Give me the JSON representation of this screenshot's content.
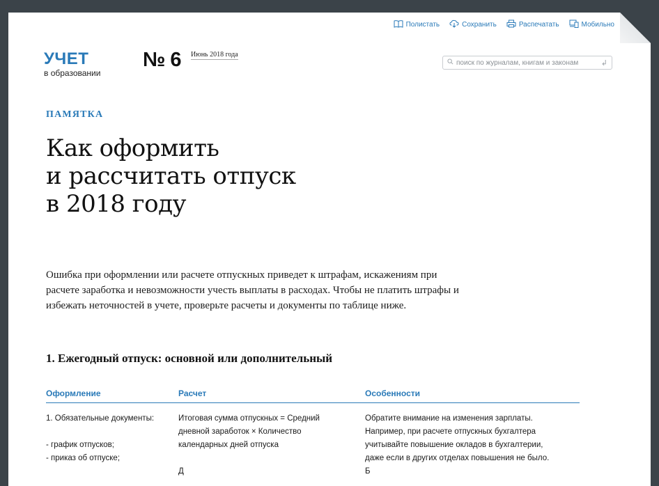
{
  "toolbar": {
    "items": [
      {
        "label": "Полистать",
        "icon": "book-icon"
      },
      {
        "label": "Сохранить",
        "icon": "cloud-download-icon"
      },
      {
        "label": "Распечатать",
        "icon": "printer-icon"
      },
      {
        "label": "Мобильно",
        "icon": "devices-icon"
      }
    ]
  },
  "logo": {
    "main": "УЧЕТ",
    "sub": "в образовании"
  },
  "issue": {
    "number": "№ 6",
    "date": "Июнь 2018 года"
  },
  "search": {
    "placeholder": "поиск по журналам, книгам и законам"
  },
  "article": {
    "kicker": "ПАМЯТКА",
    "title_lines": [
      "Как оформить",
      "и рассчитать отпуск",
      "в 2018 году"
    ],
    "lead": "Ошибка при оформлении или расчете отпускных приведет к штрафам, искажениям при расчете заработка и невозможности учесть выплаты в расходах. Чтобы не платить штрафы и избежать неточностей в учете, проверьте расчеты и документы по таблице ниже.",
    "section_title": "1. Ежегодный отпуск: основной или дополнительный"
  },
  "table": {
    "headers": [
      "Оформление",
      "Расчет",
      "Особенности"
    ],
    "col1": [
      "1. Обязательные документы:",
      "",
      "- график отпусков;",
      "- приказ об отпуске;"
    ],
    "col2": [
      "Итоговая сумма отпускных = Средний",
      "дневной заработок × Количество",
      "календарных дней отпуска",
      "",
      "Д"
    ],
    "col3": [
      "Обратите внимание на изменения зарплаты.",
      "Например, при расчете отпускных бухгалтера",
      "учитывайте повышение окладов в бухгалтерии,",
      "даже если в других отделах повышения не было.",
      "Б"
    ]
  },
  "colors": {
    "accent": "#2a7ab8",
    "frame": "#3b4349"
  }
}
